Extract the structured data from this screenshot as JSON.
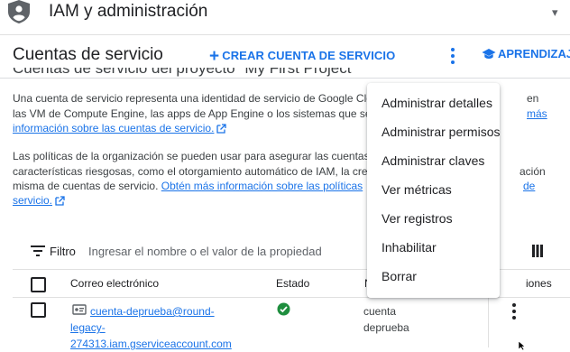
{
  "topbar": {
    "title": "IAM y administración"
  },
  "toolbar": {
    "page_title": "Cuentas de servicio",
    "create_label": "CREAR CUENTA DE SERVICIO",
    "learn_label": "APRENDIZAJE"
  },
  "content": {
    "heading_partial": "Cuentas de servicio del proyecto \"My First Project\"",
    "para1": {
      "line1": "Una cuenta de servicio representa una identidad de servicio de Google Clo",
      "line1_tail": "en",
      "line2": "las VM de Compute Engine, las apps de App Engine o los sistemas que se",
      "line2_link": "más",
      "line3_link": "información sobre las cuentas de servicio."
    },
    "para2": {
      "line1": "Las políticas de la organización se pueden usar para asegurar las cuentas",
      "line2": "características riesgosas, como el otorgamiento automático de IAM, la cre",
      "line2_tail": "ación",
      "line3": "misma de cuentas de servicio.",
      "line3_link": "Obtén más información sobre las políticas",
      "line3_tail_link": "de",
      "line4_link": "servicio."
    }
  },
  "filter": {
    "label": "Filtro",
    "placeholder": "Ingresar el nombre o el valor de la propiedad"
  },
  "table": {
    "headers": {
      "email": "Correo electrónico",
      "status": "Estado",
      "name_partial": "N",
      "actions_partial": "iones"
    },
    "rows": [
      {
        "email_lines": [
          "cuenta-deprueba@round-",
          "legacy-",
          "274313.iam.gserviceaccount.com"
        ],
        "status": "enabled",
        "name_lines": [
          "cuenta",
          "deprueba"
        ]
      }
    ]
  },
  "menu": {
    "items": [
      "Administrar detalles",
      "Administrar permisos",
      "Administrar claves",
      "Ver métricas",
      "Ver registros",
      "Inhabilitar",
      "Borrar"
    ]
  },
  "colors": {
    "accent": "#1a73e8",
    "status_ok": "#1e8e3e",
    "text": "#202124"
  },
  "icons": [
    "iam-account-icon",
    "dropdown-chevron-icon",
    "add-icon",
    "more-vert-icon",
    "school-icon",
    "external-link-icon",
    "filter-list-icon",
    "column-display-icon",
    "key-icon",
    "check-circle-icon"
  ]
}
